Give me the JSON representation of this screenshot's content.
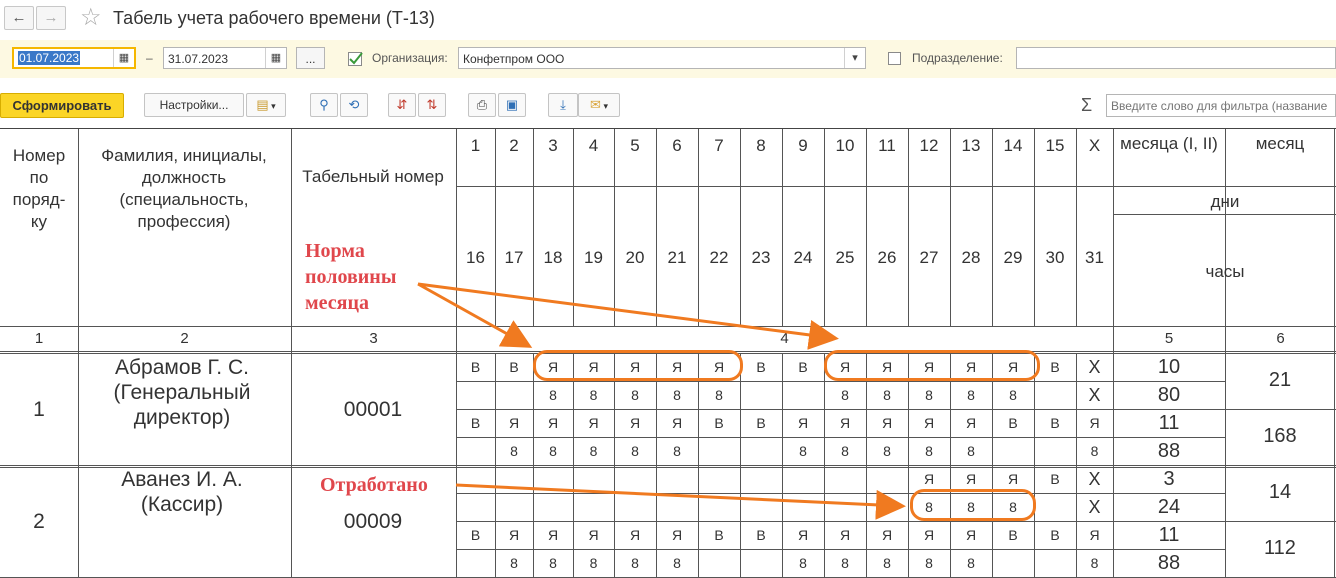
{
  "window": {
    "title": "Табель учета рабочего времени (Т-13)"
  },
  "nav": {
    "back_icon": "←",
    "forward_icon": "→",
    "star_icon": "☆"
  },
  "filters": {
    "date_from": "01.07.2023",
    "dash": "–",
    "date_to": "31.07.2023",
    "period_button": "...",
    "org_label": "Организация:",
    "org_value": "Конфетпром ООО",
    "dept_label": "Подразделение:",
    "dept_value": ""
  },
  "toolbar": {
    "generate": "Сформировать",
    "settings": "Настройки...",
    "sigma": "Σ",
    "search_placeholder": "Введите слово для фильтра (название"
  },
  "table": {
    "headers": {
      "num": "Номер по поряд- ку",
      "name": "Фамилия, инициалы, должность (специальность, профессия)",
      "tabnum": "Табельный номер",
      "half_month": "месяца (I, II)",
      "month": "месяц",
      "days": "дни",
      "hours": "часы",
      "half_mark": "X"
    },
    "days_row1": [
      "1",
      "2",
      "3",
      "4",
      "5",
      "6",
      "7",
      "8",
      "9",
      "10",
      "11",
      "12",
      "13",
      "14",
      "15",
      "X"
    ],
    "days_row2": [
      "16",
      "17",
      "18",
      "19",
      "20",
      "21",
      "22",
      "23",
      "24",
      "25",
      "26",
      "27",
      "28",
      "29",
      "30",
      "31"
    ],
    "col_numbers": [
      "1",
      "2",
      "3",
      "4",
      "5",
      "6"
    ],
    "employees": [
      {
        "num": "1",
        "name": "Абрамов Г. С. (Генеральный директор)",
        "tab": "00001",
        "rows": [
          [
            "В",
            "В",
            "Я",
            "Я",
            "Я",
            "Я",
            "Я",
            "В",
            "В",
            "Я",
            "Я",
            "Я",
            "Я",
            "Я",
            "В",
            "X"
          ],
          [
            "",
            "",
            "8",
            "8",
            "8",
            "8",
            "8",
            "",
            "",
            "8",
            "8",
            "8",
            "8",
            "8",
            "",
            "X"
          ],
          [
            "В",
            "Я",
            "Я",
            "Я",
            "Я",
            "Я",
            "В",
            "В",
            "Я",
            "Я",
            "Я",
            "Я",
            "Я",
            "В",
            "В",
            "Я"
          ],
          [
            "",
            "8",
            "8",
            "8",
            "8",
            "8",
            "",
            "",
            "8",
            "8",
            "8",
            "8",
            "8",
            "",
            "",
            "8"
          ]
        ],
        "half": [
          "10",
          "80",
          "11",
          "88"
        ],
        "month": [
          "21",
          "168"
        ]
      },
      {
        "num": "2",
        "name": "Аванез И. А. (Кассир)",
        "tab": "00009",
        "rows": [
          [
            "",
            "",
            "",
            "",
            "",
            "",
            "",
            "",
            "",
            "",
            "",
            "Я",
            "Я",
            "Я",
            "В",
            "X"
          ],
          [
            "",
            "",
            "",
            "",
            "",
            "",
            "",
            "",
            "",
            "",
            "",
            "8",
            "8",
            "8",
            "",
            "X"
          ],
          [
            "В",
            "Я",
            "Я",
            "Я",
            "Я",
            "Я",
            "В",
            "В",
            "Я",
            "Я",
            "Я",
            "Я",
            "Я",
            "В",
            "В",
            "Я"
          ],
          [
            "",
            "8",
            "8",
            "8",
            "8",
            "8",
            "",
            "",
            "8",
            "8",
            "8",
            "8",
            "8",
            "",
            "",
            "8"
          ]
        ],
        "half": [
          "3",
          "24",
          "11",
          "88"
        ],
        "month": [
          "14",
          "112"
        ]
      }
    ]
  },
  "annotations": {
    "norm": "Норма половины месяца",
    "worked": "Отработано"
  },
  "colors": {
    "accent_yellow": "#fbd526",
    "annotation_red": "#e0474c",
    "annotation_orange": "#f07a20",
    "panel_bg": "#fdf9e2"
  }
}
